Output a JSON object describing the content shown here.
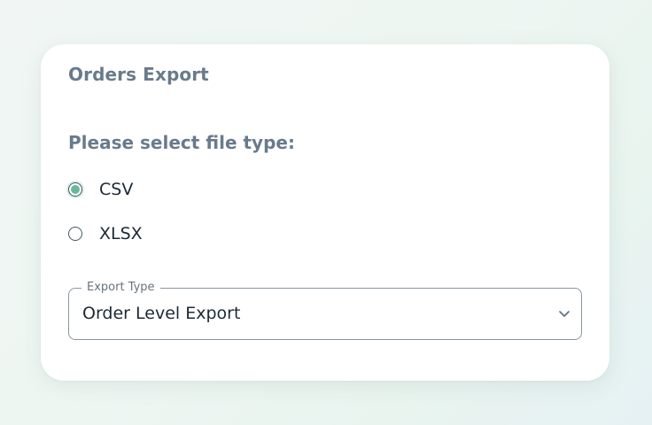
{
  "card": {
    "title": "Orders Export"
  },
  "file_type": {
    "prompt": "Please select file type:",
    "options": [
      {
        "label": "CSV",
        "checked": true
      },
      {
        "label": "XLSX",
        "checked": false
      }
    ]
  },
  "export_type": {
    "legend": "Export Type",
    "value": "Order Level Export"
  },
  "colors": {
    "accent": "#6bb59d",
    "heading": "#687b8c",
    "text": "#1c2a35",
    "border": "#8a96a0"
  },
  "icons": {
    "dropdown": "chevron-down-icon"
  }
}
